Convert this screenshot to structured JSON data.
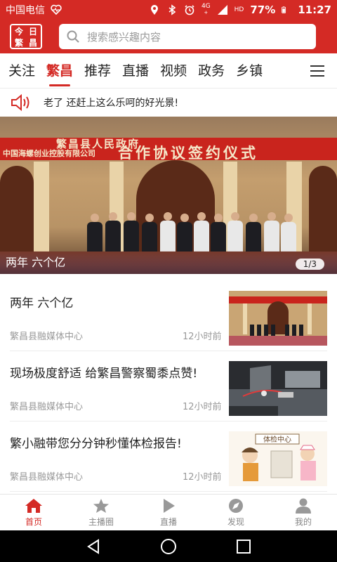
{
  "status_bar": {
    "carrier": "中国电信",
    "battery_percent": "77%",
    "time": "11:27",
    "network": "4G",
    "network_sub": "HD",
    "icons": [
      "heart-rate-icon",
      "location-icon",
      "bluetooth-icon",
      "alarm-icon",
      "signal-icon",
      "battery-icon"
    ]
  },
  "header": {
    "logo_chars": [
      "今",
      "日",
      "繁",
      "昌"
    ],
    "search_placeholder": "搜索感兴趣内容"
  },
  "tabs": {
    "items": [
      "关注",
      "繁昌",
      "推荐",
      "直播",
      "视频",
      "政务",
      "乡镇"
    ],
    "active_index": 1
  },
  "notice": {
    "text": "老了 还赶上这么乐呵的好光景!"
  },
  "banner": {
    "caption": "两年 六个亿",
    "pager": "1/3",
    "sign_line1": "繁昌县人民政府",
    "sign_line2": "中国海螺创业控股有限公司",
    "sign_main": "合作协议签约仪式"
  },
  "news": [
    {
      "title": "两年 六个亿",
      "source": "繁昌县融媒体中心",
      "time": "12小时前"
    },
    {
      "title": "现场极度舒适 给繁昌警察蜀黍点赞!",
      "source": "繁昌县融媒体中心",
      "time": "12小时前"
    },
    {
      "title": "繁小融带您分分钟秒懂体检报告!",
      "source": "繁昌县融媒体中心",
      "time": "12小时前"
    }
  ],
  "thumb3_sign": "体检中心",
  "bottom_nav": [
    {
      "label": "首页",
      "icon": "home-icon",
      "active": true
    },
    {
      "label": "主播圈",
      "icon": "star-icon",
      "active": false
    },
    {
      "label": "直播",
      "icon": "play-icon",
      "active": false
    },
    {
      "label": "发现",
      "icon": "compass-icon",
      "active": false
    },
    {
      "label": "我的",
      "icon": "user-icon",
      "active": false
    }
  ],
  "colors": {
    "brand_red": "#d42a25",
    "inactive_gray": "#888888"
  }
}
